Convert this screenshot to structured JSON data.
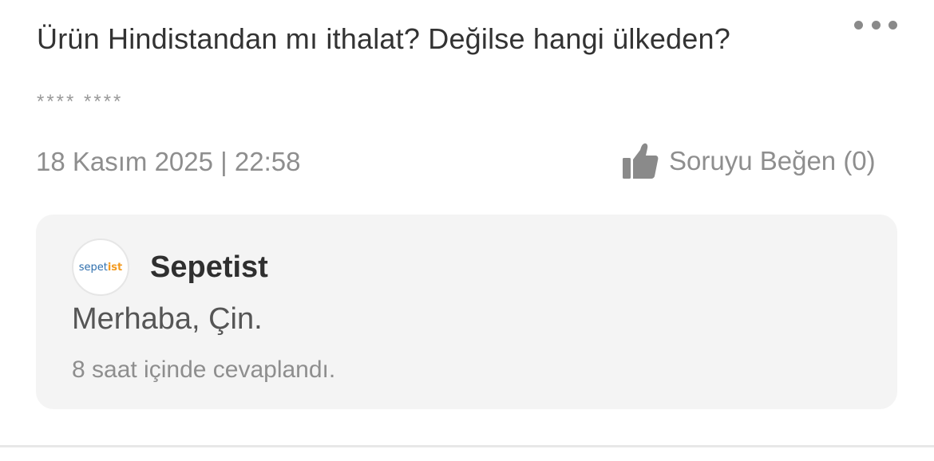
{
  "question": {
    "text": "Ürün Hindistandan mı ithalat? Değilse hangi ülkeden?",
    "author": "**** ****",
    "date": "18 Kasım 2025 | 22:58",
    "like_label": "Soruyu Beğen (0)",
    "more_icon": "more-horizontal-icon",
    "like_icon": "thumbs-up-icon"
  },
  "answer": {
    "seller_logo_part1": "sepet",
    "seller_logo_part2": "ist",
    "seller_name": "Sepetist",
    "text": "Merhaba, Çin.",
    "response_time": "8 saat içinde cevaplandı."
  },
  "colors": {
    "card_background": "#f4f4f4",
    "muted_text": "#8e8e8e",
    "logo_blue": "#2f6fad",
    "logo_orange": "#f39a1f"
  }
}
